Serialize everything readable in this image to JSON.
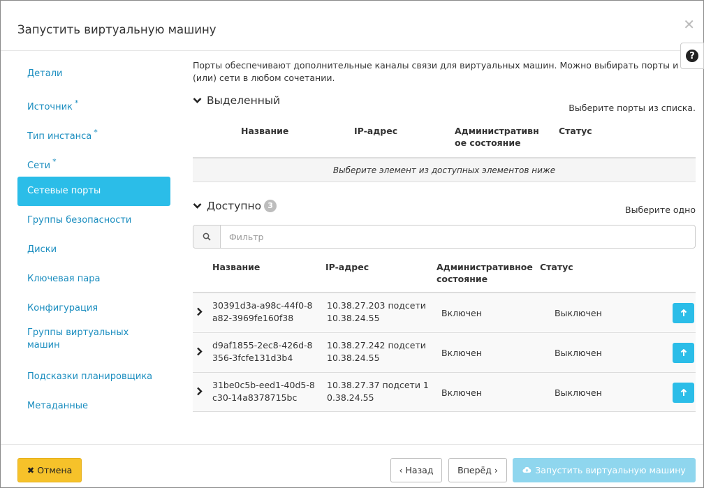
{
  "dialog": {
    "title": "Запустить виртуальную машину",
    "close_icon": "close-icon",
    "help_icon": "question-circle-icon"
  },
  "sidebar": {
    "items": [
      {
        "label": "Детали",
        "required": false,
        "active": false
      },
      {
        "label": "Источник",
        "required": true,
        "active": false
      },
      {
        "label": "Тип инстанса",
        "required": true,
        "active": false
      },
      {
        "label": "Сети",
        "required": true,
        "active": false
      },
      {
        "label": "Сетевые порты",
        "required": false,
        "active": true
      },
      {
        "label": "Группы безопасности",
        "required": false,
        "active": false
      },
      {
        "label": "Диски",
        "required": false,
        "active": false
      },
      {
        "label": "Ключевая пара",
        "required": false,
        "active": false
      },
      {
        "label": "Конфигурация",
        "required": false,
        "active": false
      },
      {
        "label": "Группы виртуальных машин",
        "required": false,
        "active": false
      },
      {
        "label": "Подсказки планировщика",
        "required": false,
        "active": false
      },
      {
        "label": "Метаданные",
        "required": false,
        "active": false
      }
    ],
    "required_mark": "*"
  },
  "main": {
    "intro": "Порты обеспечивают дополнительные каналы связи для виртуальных машин. Можно выбирать порты и (или) сети в любом сочетании.",
    "allocated": {
      "title": "Выделенный",
      "hint": "Выберите порты из списка.",
      "columns": [
        "Название",
        "IP-адрес",
        "Административн ое состояние",
        "Статус"
      ],
      "empty_text": "Выберите элемент из доступных элементов ниже"
    },
    "available": {
      "title": "Доступно",
      "count": "3",
      "hint": "Выберите одно",
      "filter_placeholder": "Фильтр",
      "columns": [
        "Название",
        "IP-адрес",
        "Административное состояние",
        "Статус"
      ],
      "rows": [
        {
          "name": "30391d3a-a98c-44f0-8a82-3969fe160f38",
          "name_l1": "30391d3a-a98c-44f0-8",
          "name_l2": "a82-3969fe160f38",
          "ip_l1": "10.38.27.203 подсети",
          "ip_l2": "10.38.24.55",
          "admin_state": "Включен",
          "status": "Выключен"
        },
        {
          "name": "d9af1855-2ec8-426d-8356-3fcfe131d3b4",
          "name_l1": "d9af1855-2ec8-426d-8",
          "name_l2": "356-3fcfe131d3b4",
          "ip_l1": "10.38.27.242 подсети",
          "ip_l2": "10.38.24.55",
          "admin_state": "Включен",
          "status": "Выключен"
        },
        {
          "name": "31be0c5b-eed1-40d5-8c30-14a8378715bc",
          "name_l1": "31be0c5b-eed1-40d5-8",
          "name_l2": "c30-14a8378715bc",
          "ip_l1": "10.38.27.37 подсети 1",
          "ip_l2": "0.38.24.55",
          "admin_state": "Включен",
          "status": "Выключен"
        }
      ]
    }
  },
  "footer": {
    "cancel": "Отмена",
    "back": "‹ Назад",
    "next": "Вперёд ›",
    "launch": "Запустить виртуальную машину"
  },
  "colors": {
    "accent": "#2bbde8",
    "link": "#1a8dbf",
    "cancel": "#f6c22a",
    "launch_disabled": "#8fd6ee"
  }
}
